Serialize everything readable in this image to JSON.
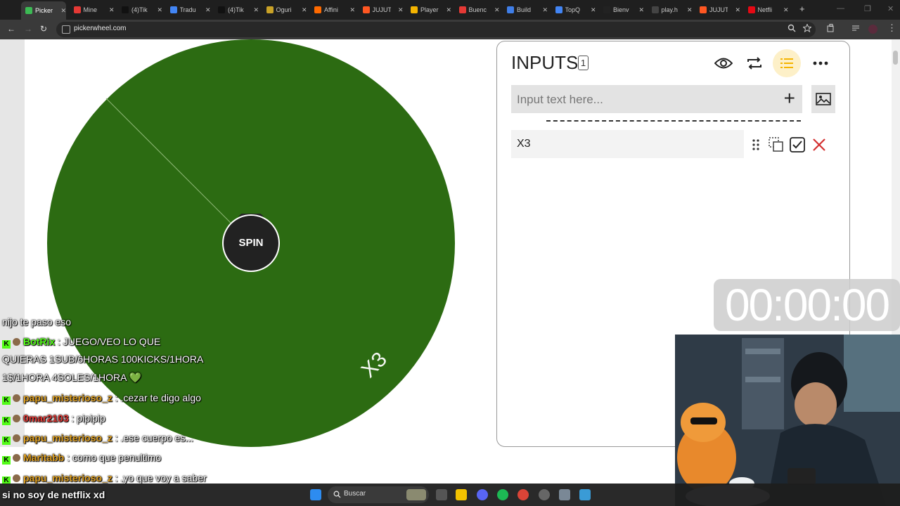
{
  "browser": {
    "tabs": [
      {
        "title": "Picker",
        "color": "#3cba54",
        "active": true
      },
      {
        "title": "Mine",
        "color": "#e53935"
      },
      {
        "title": "(4)Tik",
        "color": "#111111"
      },
      {
        "title": "Tradu",
        "color": "#4285f4"
      },
      {
        "title": "(4)Tik",
        "color": "#111111"
      },
      {
        "title": "Oguri",
        "color": "#c9a227"
      },
      {
        "title": "Affini",
        "color": "#ff6a00"
      },
      {
        "title": "JUJUT",
        "color": "#ff5722"
      },
      {
        "title": "Player",
        "color": "#f4b400"
      },
      {
        "title": "Buenc",
        "color": "#e53935"
      },
      {
        "title": "Build",
        "color": "#3f7ee8"
      },
      {
        "title": "TopQ",
        "color": "#4285f4"
      },
      {
        "title": "Bienv",
        "color": "#222222"
      },
      {
        "title": "play.h",
        "color": "#444444"
      },
      {
        "title": "JUJUT",
        "color": "#ff5722"
      },
      {
        "title": "Netfli",
        "color": "#e50914"
      }
    ],
    "tab_close_glyph": "✕",
    "new_tab_glyph": "+",
    "url": "pickerwheel.com",
    "nav_back": "←",
    "nav_forward": "→",
    "nav_reload": "↻"
  },
  "wheel": {
    "color": "#2c6b12",
    "spin_label": "SPIN",
    "entry_on_wheel": "X3"
  },
  "panel": {
    "title": "INPUTS",
    "count": "1",
    "input_placeholder": "Input text here...",
    "entries": [
      {
        "label": "X3"
      }
    ],
    "accent": "#f5b400",
    "close_color": "#d32f2f"
  },
  "timer": "00:00:00",
  "chat": [
    {
      "user": "",
      "user_color": "#ffffff",
      "text": "nijo te paso eso"
    },
    {
      "user": "BotRix",
      "user_color": "#53fc18",
      "text": " : JUEGO/VEO LO QUE"
    },
    {
      "user": "",
      "user_color": "#ffffff",
      "text": "QUIERAS 1SUB/6HORAS 100KICKS/1HORA"
    },
    {
      "user": "",
      "user_color": "#ffffff",
      "text": "1$/1HORA 4SOLES/1HORA 💚"
    },
    {
      "user": "papu_misterioso_z",
      "user_color": "#e0a020",
      "text": " : .cezar te digo algo"
    },
    {
      "user": "0mar2103",
      "user_color": "#e53935",
      "text": " : pipipip"
    },
    {
      "user": "papu_misterioso_z",
      "user_color": "#e0a020",
      "text": " : .ese cuerpo es..."
    },
    {
      "user": "Maritabb",
      "user_color": "#e0a020",
      "text": " : como que penultimo"
    },
    {
      "user": "papu_misterioso_z",
      "user_color": "#e0a020",
      "text": " : .yo que voy a saber"
    }
  ],
  "caption": "si no soy de netflix xd",
  "taskbar": {
    "search_label": "Buscar"
  }
}
